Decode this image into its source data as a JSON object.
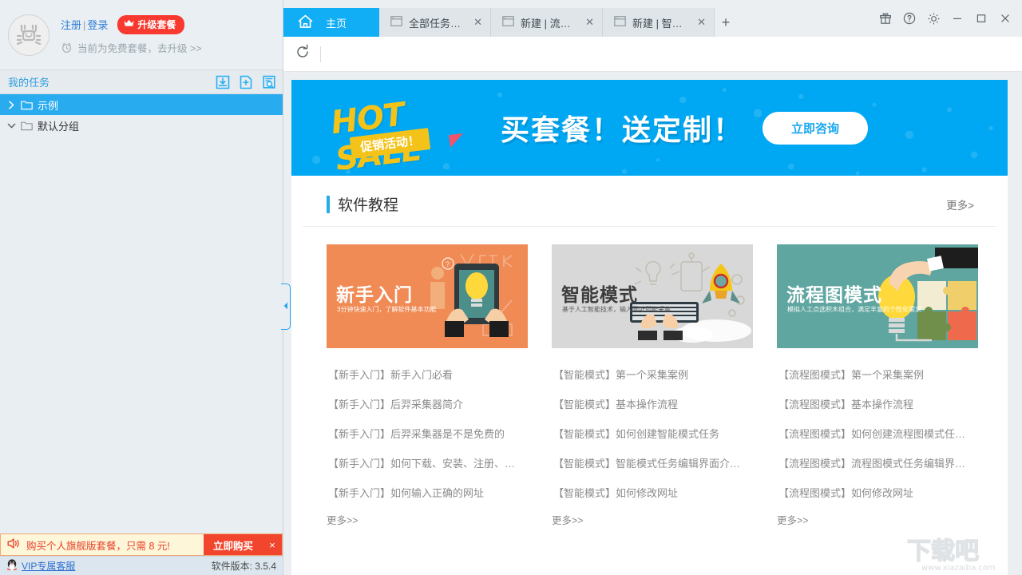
{
  "sidebar": {
    "account": {
      "avatar_icon": "crab-robot-avatar",
      "register_label": "注册",
      "separator": "|",
      "login_label": "登录",
      "upgrade_label": "升级套餐",
      "upgrade_icon": "crown-icon",
      "crown_color": "#ffffff",
      "upgrade_bg": "#f8392f",
      "clock_icon": "alarm-clock-icon",
      "plan_notice": "当前为免费套餐，去升级 >>"
    },
    "tasks": {
      "title": "我的任务",
      "title_color": "#2f9ee0",
      "icons": [
        {
          "name": "import-task-icon",
          "title": "导入"
        },
        {
          "name": "new-task-icon",
          "title": "新建"
        },
        {
          "name": "search-task-icon",
          "title": "搜索"
        }
      ],
      "tree": [
        {
          "label": "示例",
          "expand_icon": "chevron-right-icon",
          "folder_icon": "folder-icon",
          "selected": true
        },
        {
          "label": "默认分组",
          "expand_icon": "chevron-down-icon",
          "folder_icon": "folder-icon",
          "selected": false
        }
      ],
      "selected_bg": "#29abf0"
    },
    "promo": {
      "speaker_icon": "speaker-icon",
      "text": "购买个人旗舰版套餐，只需 8 元!",
      "buy_label": "立即购买",
      "close_label": "×",
      "bg": "#fdf6d8",
      "accent": "#f2452e"
    },
    "status": {
      "qq_icon": "penguin-icon",
      "vip_label": "VIP专属客服",
      "version_label": "软件版本: 3.5.4"
    },
    "collapse": {
      "icon": "collapse-left-icon"
    }
  },
  "titlebar": {
    "tabs": [
      {
        "label": "主页",
        "icon": "home-icon",
        "active": true,
        "closable": false
      },
      {
        "label": "全部任务列...",
        "icon": "window-icon",
        "active": false,
        "closable": true
      },
      {
        "label": "新建 | 流程...",
        "icon": "window-icon",
        "active": false,
        "closable": true
      },
      {
        "label": "新建 | 智能...",
        "icon": "window-icon",
        "active": false,
        "closable": true
      }
    ],
    "add_tab_label": "+",
    "window_buttons": [
      {
        "name": "gift-icon"
      },
      {
        "name": "help-icon"
      },
      {
        "name": "settings-gear-icon"
      },
      {
        "name": "minimize-icon"
      },
      {
        "name": "maximize-icon"
      },
      {
        "name": "close-icon"
      }
    ],
    "active_tab_color": "#11adf5"
  },
  "toolbar": {
    "refresh_icon": "refresh-icon"
  },
  "banner": {
    "bg_color": "#00a8f3",
    "hot_text": "HOT SALE",
    "ribbon_text": "促销活动！",
    "title": "买套餐！送定制！",
    "cta_label": "立即咨询",
    "cta_text_color": "#1aa7ef"
  },
  "tutorials": {
    "section_title": "软件教程",
    "more_label": "更多>",
    "accent": "#25ace4",
    "columns": [
      {
        "card": {
          "title": "新手入门",
          "subtitle": "3分钟快速入门，了解软件基本功能",
          "bg": "#f08b55",
          "image_name": "beginner-tutorial-banner"
        },
        "links": [
          "【新手入门】新手入门必看",
          "【新手入门】后羿采集器简介",
          "【新手入门】后羿采集器是不是免费的",
          "【新手入门】如何下载、安装、注册、…",
          "【新手入门】如何输入正确的网址"
        ],
        "more": "更多>>"
      },
      {
        "card": {
          "title": "智能模式",
          "subtitle": "基于人工智能技术，输入网址即能采集",
          "bg": "#d8d8d8",
          "image_name": "smart-mode-tutorial-banner"
        },
        "links": [
          "【智能模式】第一个采集案例",
          "【智能模式】基本操作流程",
          "【智能模式】如何创建智能模式任务",
          "【智能模式】智能模式任务编辑界面介…",
          "【智能模式】如何修改网址"
        ],
        "more": "更多>>"
      },
      {
        "card": {
          "title": "流程图模式",
          "subtitle": "模拟人工点选积木组合，满足丰富的个性化需求",
          "bg": "#5fa5a0",
          "image_name": "flowchart-mode-tutorial-banner"
        },
        "links": [
          "【流程图模式】第一个采集案例",
          "【流程图模式】基本操作流程",
          "【流程图模式】如何创建流程图模式任…",
          "【流程图模式】流程图模式任务编辑界…",
          "【流程图模式】如何修改网址"
        ],
        "more": "更多>>"
      }
    ]
  },
  "watermark": {
    "text": "下载吧",
    "url": "www.xiazaiba.com"
  }
}
